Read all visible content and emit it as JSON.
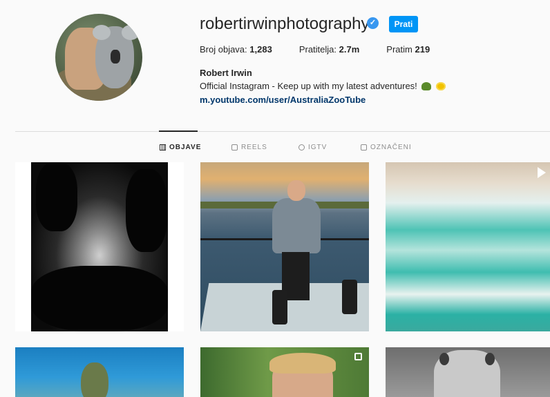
{
  "profile": {
    "username": "robertirwinphotography",
    "follow_label": "Prati",
    "stats": [
      {
        "label": "Broj objava:",
        "value": "1,283"
      },
      {
        "label": "Pratitelja:",
        "value": "2.7m"
      },
      {
        "label": "Pratim",
        "value": "219"
      }
    ],
    "full_name": "Robert Irwin",
    "bio": "Official Instagram - Keep up with my latest adventures!",
    "bio_emojis": [
      "turtle-emoji",
      "sun-emoji"
    ],
    "link": "m.youtube.com/user/AustraliaZooTube"
  },
  "tabs": [
    {
      "label": "OBJAVE",
      "icon": "grid-icon",
      "active": true
    },
    {
      "label": "REELS",
      "icon": "reels-icon",
      "active": false
    },
    {
      "label": "IGTV",
      "icon": "igtv-icon",
      "active": false
    },
    {
      "label": "OZNAČENI",
      "icon": "tagged-icon",
      "active": false
    }
  ],
  "colors": {
    "follow_button": "#0095f6",
    "verified_badge": "#3897f0",
    "link": "#00376b"
  }
}
